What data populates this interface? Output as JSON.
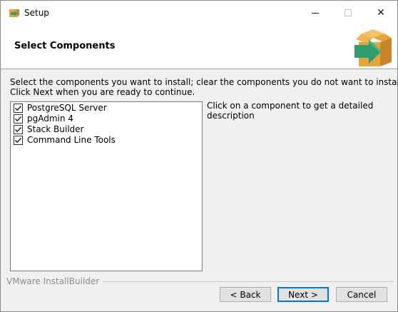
{
  "window": {
    "title": "Setup",
    "minimize_icon": "minimize-icon",
    "maximize_icon": "maximize-icon",
    "close_icon": "close-icon",
    "close_glyph": "✕"
  },
  "header": {
    "title": "Select Components",
    "logo_icon": "installer-box-arrow-icon"
  },
  "body": {
    "instruction_line1": "Select the components you want to install; clear the components you do not want to install.",
    "instruction_line2": "Click Next when you are ready to continue.",
    "components": [
      {
        "label": "PostgreSQL Server",
        "checked": true
      },
      {
        "label": "pgAdmin 4",
        "checked": true
      },
      {
        "label": "Stack Builder",
        "checked": true
      },
      {
        "label": "Command Line Tools",
        "checked": true
      }
    ],
    "description_line1": "Click on a component to get a detailed",
    "description_line2": "description"
  },
  "footer": {
    "brand": "VMware InstallBuilder",
    "back_label": "< Back",
    "next_label": "Next >",
    "cancel_label": "Cancel"
  },
  "colors": {
    "accent": "#0078d7",
    "logo_box": "#e8a33a",
    "logo_arrow": "#2e9e6e"
  }
}
